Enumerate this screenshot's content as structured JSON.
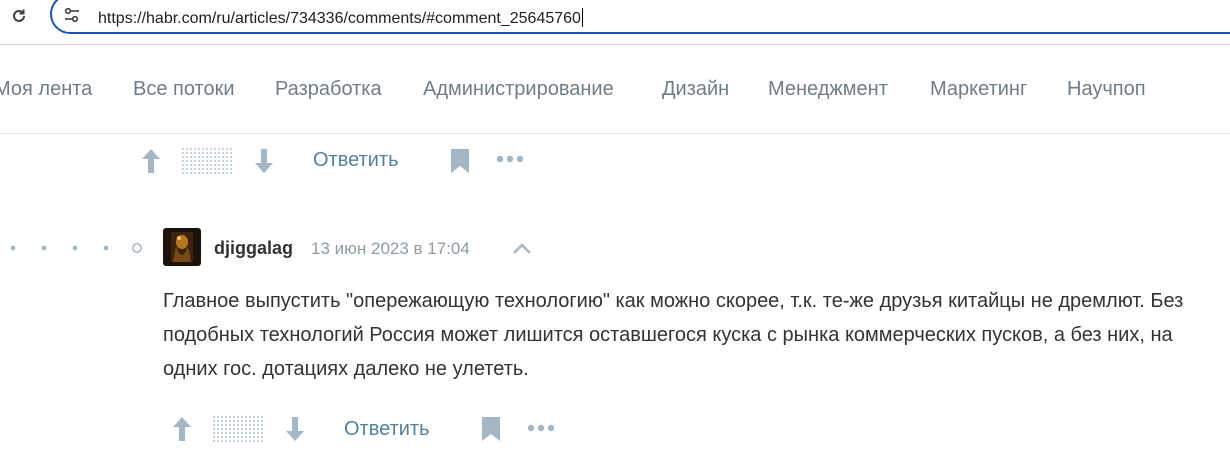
{
  "browser": {
    "url": "https://habr.com/ru/articles/734336/comments/#comment_25645760",
    "reload_icon": "reload-icon",
    "site_info_icon": "tune-icon"
  },
  "nav": {
    "items": [
      {
        "label": "Моя лента"
      },
      {
        "label": "Все потоки"
      },
      {
        "label": "Разработка"
      },
      {
        "label": "Администрирование"
      },
      {
        "label": "Дизайн"
      },
      {
        "label": "Менеджмент"
      },
      {
        "label": "Маркетинг"
      },
      {
        "label": "Научпоп"
      }
    ]
  },
  "prev_comment": {
    "reply_label": "Ответить"
  },
  "comment": {
    "author": "djiggalag",
    "date": "13 июн 2023 в 17:04",
    "body": "Главное выпустить \"опережающую технологию\" как можно скорее, т.к. те-же друзья китайцы не дремлют. Без подобных технологий Россия может лишится оставшегося куска с рынка коммерческих пусков, а без них, на одних гос. дотациях далеко не улететь.",
    "reply_label": "Ответить"
  },
  "colors": {
    "accent_link": "#54819f",
    "nav_text": "#6f7d86",
    "icon_gray": "#a5b7c4",
    "omnibox_border": "#1a56b8"
  }
}
